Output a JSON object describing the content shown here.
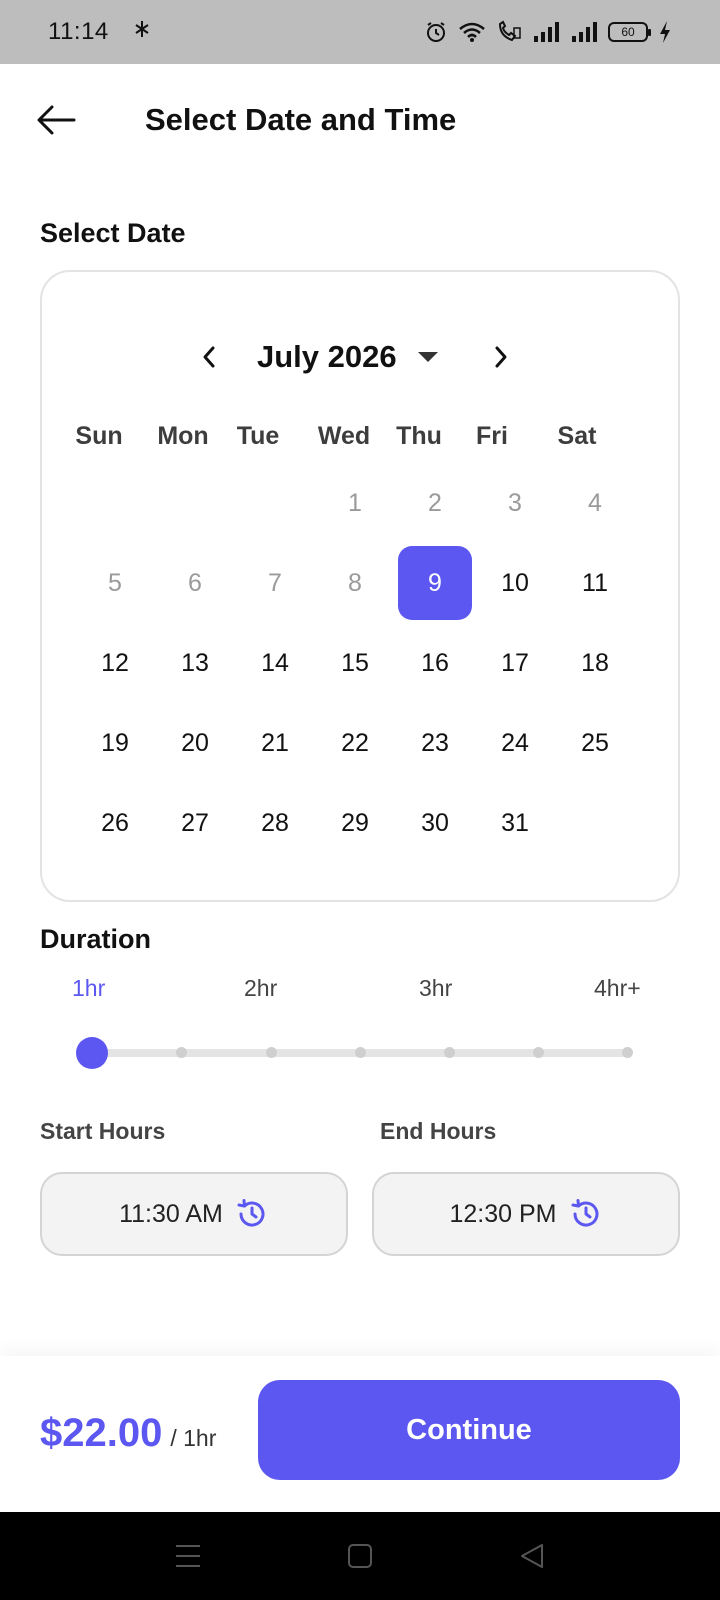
{
  "status_bar": {
    "time": "11:14",
    "battery": "60",
    "icons": [
      "bluetooth-icon",
      "alarm-icon",
      "wifi-icon",
      "call-icon",
      "signal-icon",
      "signal-icon",
      "battery-icon",
      "charging-icon"
    ]
  },
  "header": {
    "title": "Select Date and Time",
    "back_icon": "back-arrow-icon"
  },
  "date_section": {
    "label": "Select Date"
  },
  "calendar": {
    "month_label": "July 2026",
    "weekdays": [
      "Sun",
      "Mon",
      "Tue",
      "Wed",
      "Thu",
      "Fri",
      "Sat"
    ],
    "days": [
      "1",
      "2",
      "3",
      "4",
      "5",
      "6",
      "7",
      "8",
      "9",
      "10",
      "11",
      "12",
      "13",
      "14",
      "15",
      "16",
      "17",
      "18",
      "19",
      "20",
      "21",
      "22",
      "23",
      "24",
      "25",
      "26",
      "27",
      "28",
      "29",
      "30",
      "31"
    ],
    "first_weekday_index": 3,
    "selected_day": "9",
    "past_days": [
      "1",
      "2",
      "3",
      "4",
      "5",
      "6",
      "7",
      "8"
    ],
    "accent_color": "#5b57f0"
  },
  "duration": {
    "label": "Duration",
    "options": [
      "1hr",
      "2hr",
      "3hr",
      "4hr+"
    ],
    "selected": "1hr"
  },
  "hours": {
    "start_label": "Start Hours",
    "start_value": "11:30 AM",
    "end_label": "End Hours",
    "end_value": "12:30 PM"
  },
  "footer": {
    "price": "$22.00",
    "price_unit": "/ 1hr",
    "continue_label": "Continue"
  }
}
